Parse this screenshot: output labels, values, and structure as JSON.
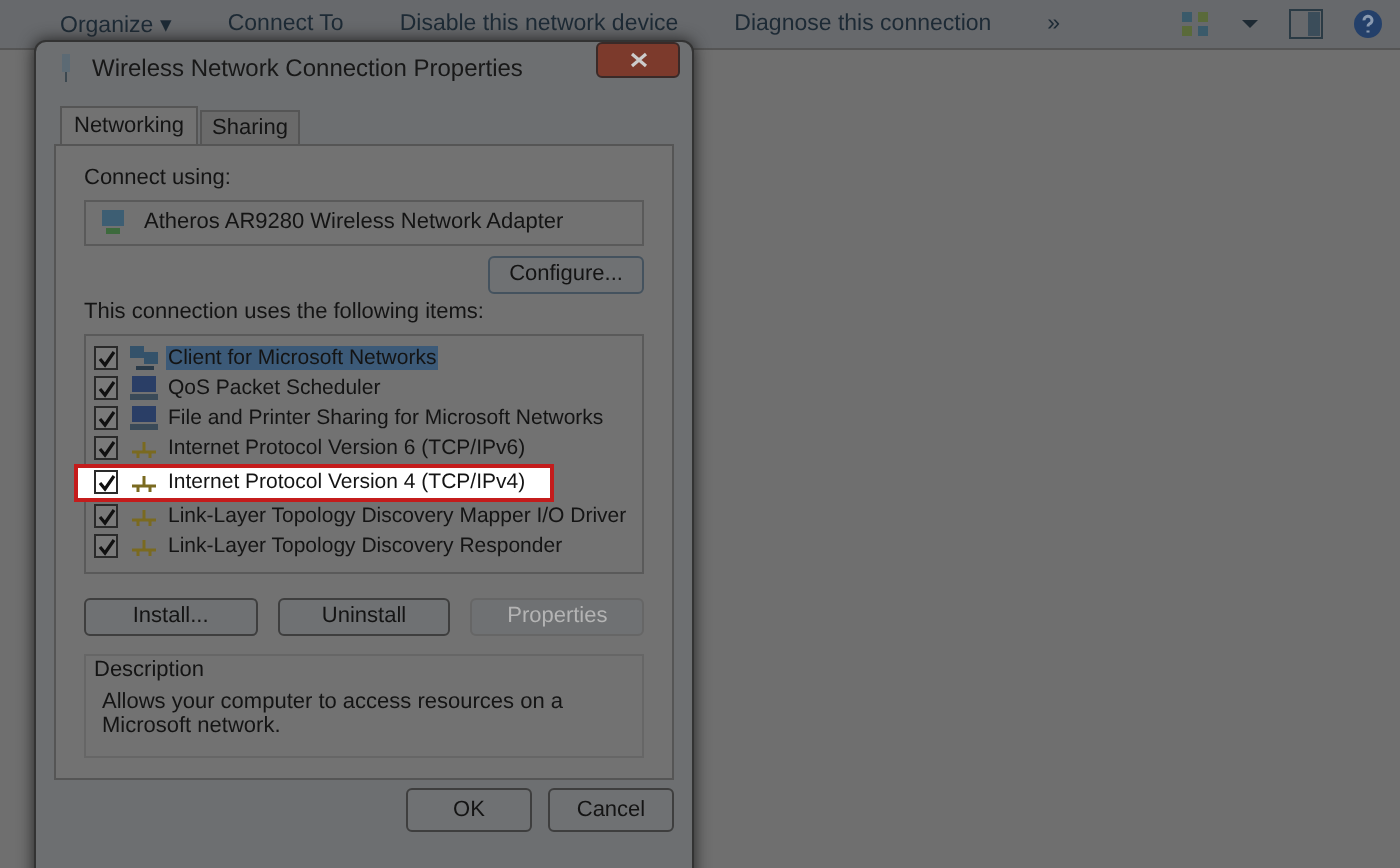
{
  "toolbar": {
    "items": [
      {
        "label": "Organize ▾"
      },
      {
        "label": "Connect To"
      },
      {
        "label": "Disable this network device"
      },
      {
        "label": "Diagnose this connection"
      },
      {
        "label": "»"
      }
    ]
  },
  "dialog": {
    "title": "Wireless Network Connection Properties",
    "tabs": [
      {
        "label": "Networking",
        "selected": true
      },
      {
        "label": "Sharing",
        "selected": false
      }
    ],
    "connect_using_label": "Connect using:",
    "adapter": "Atheros AR9280 Wireless Network Adapter",
    "configure_button": "Configure...",
    "items_label": "This connection uses the following items:",
    "items": [
      {
        "kind": "client",
        "label": "Client for Microsoft Networks",
        "checked": true,
        "selected": true,
        "highlighted": false
      },
      {
        "kind": "service",
        "label": "QoS Packet Scheduler",
        "checked": true,
        "selected": false,
        "highlighted": false
      },
      {
        "kind": "service",
        "label": "File and Printer Sharing for Microsoft Networks",
        "checked": true,
        "selected": false,
        "highlighted": false
      },
      {
        "kind": "protocol",
        "label": "Internet Protocol Version 6 (TCP/IPv6)",
        "checked": true,
        "selected": false,
        "highlighted": false
      },
      {
        "kind": "protocol",
        "label": "Internet Protocol Version 4 (TCP/IPv4)",
        "checked": true,
        "selected": false,
        "highlighted": true
      },
      {
        "kind": "protocol",
        "label": "Link-Layer Topology Discovery Mapper I/O Driver",
        "checked": true,
        "selected": false,
        "highlighted": false
      },
      {
        "kind": "protocol",
        "label": "Link-Layer Topology Discovery Responder",
        "checked": true,
        "selected": false,
        "highlighted": false
      }
    ],
    "item_buttons": [
      {
        "label": "Install...",
        "disabled": false
      },
      {
        "label": "Uninstall",
        "disabled": false
      },
      {
        "label": "Properties",
        "disabled": true
      }
    ],
    "description_title": "Description",
    "description": "Allows your computer to access resources on a Microsoft network.",
    "buttons": [
      {
        "label": "OK"
      },
      {
        "label": "Cancel"
      }
    ]
  }
}
